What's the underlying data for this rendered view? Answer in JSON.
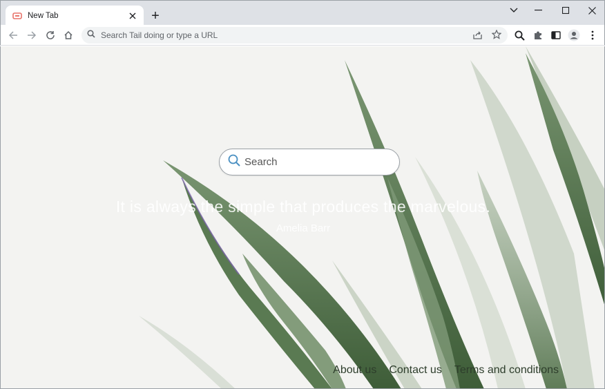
{
  "browser": {
    "tab": {
      "title": "New Tab",
      "favicon": "tail-logo-icon"
    },
    "newtab_symbol": "+",
    "omnibox": {
      "placeholder": "Search Tail doing or type a URL"
    }
  },
  "page": {
    "search": {
      "placeholder": "Search"
    },
    "quote": "It is always the simple that produces the marvelous.",
    "author": "Amelia Barr",
    "footer_links": [
      "About us",
      "Contact us",
      "Terms and conditions"
    ]
  },
  "colors": {
    "accent_icon": "#4a90c2",
    "favicon": "#e8736b"
  }
}
